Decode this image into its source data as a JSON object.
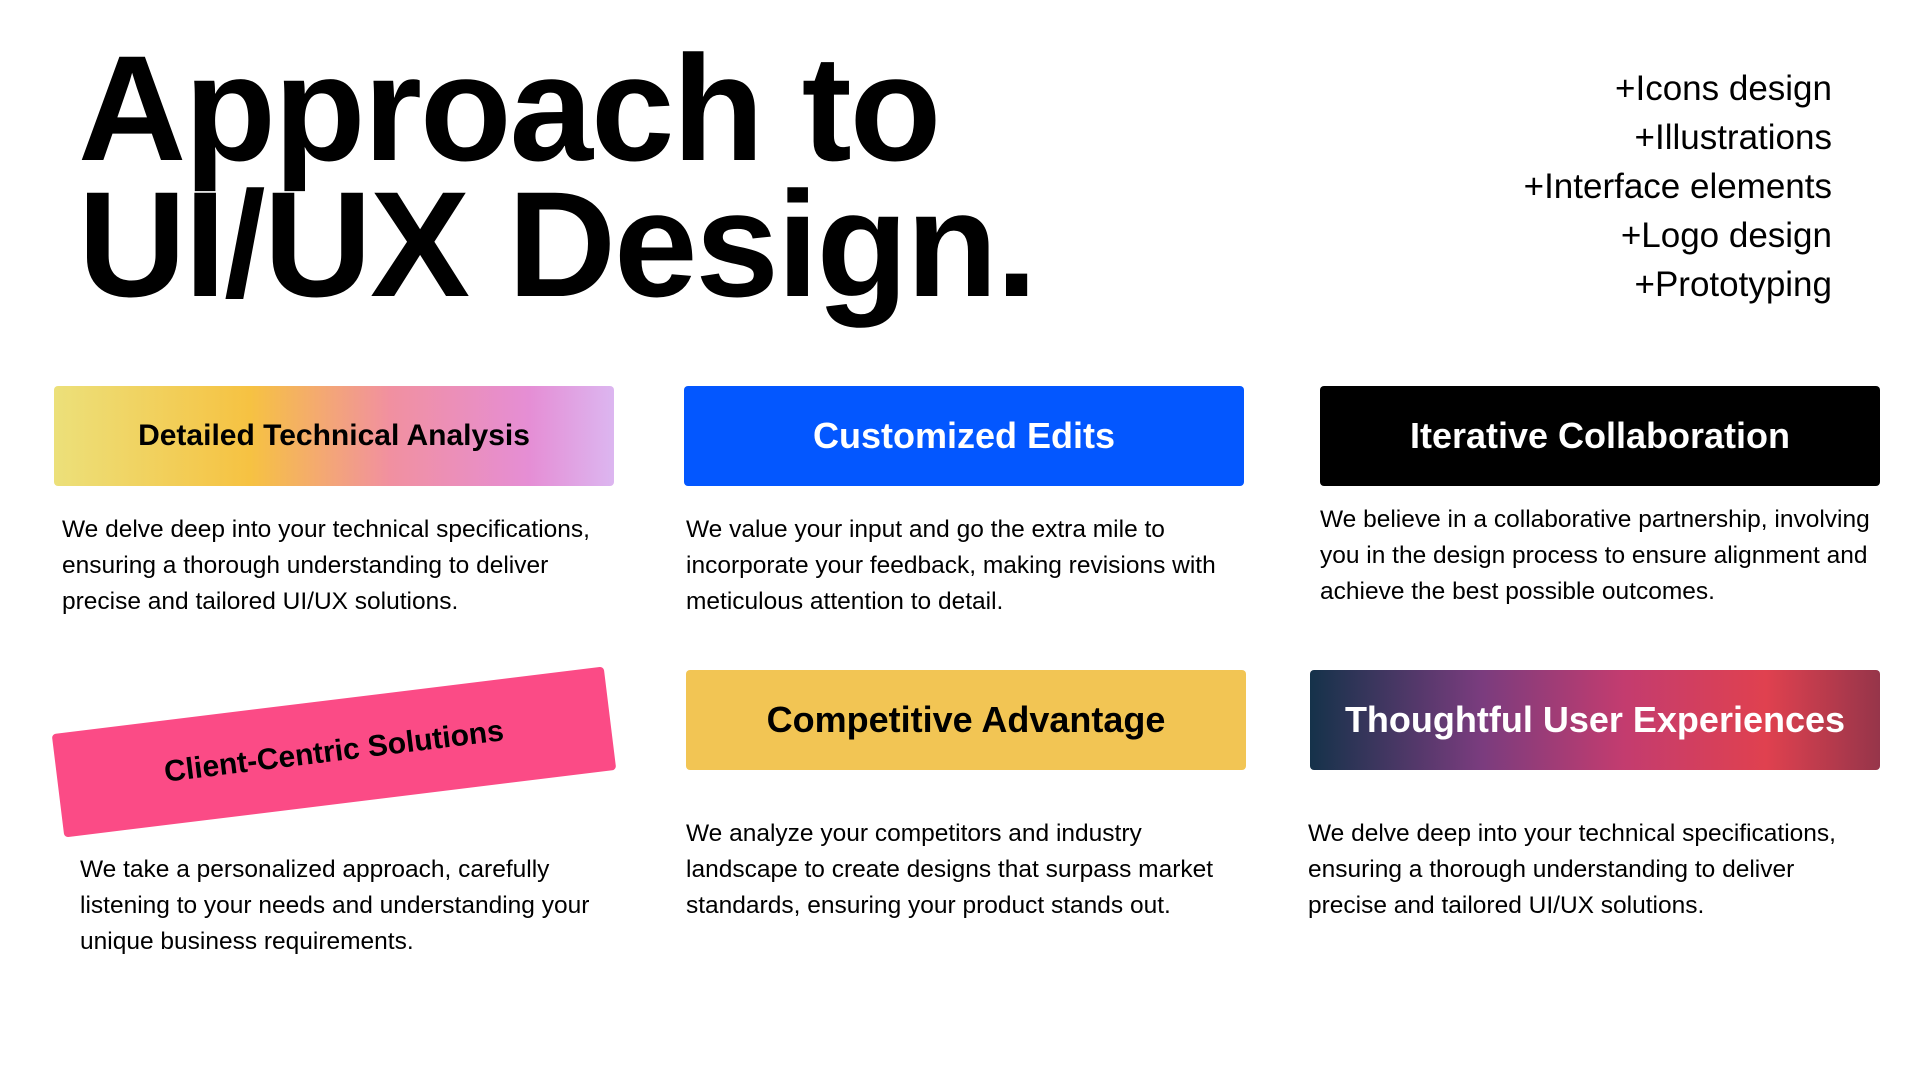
{
  "title": {
    "line1": "Approach to",
    "line2": "UI/UX Design."
  },
  "services": [
    "+Icons design",
    "+Illustrations",
    "+Interface elements",
    "+Logo design",
    "+Prototyping"
  ],
  "cards": [
    {
      "label": "Detailed Technical Analysis",
      "text": "We delve deep into your technical specifications, ensuring a thorough understanding to deliver precise and tailored UI/UX solutions."
    },
    {
      "label": "Customized Edits",
      "text": "We value your input and go the extra mile to incorporate your feedback, making revisions with meticulous attention to detail."
    },
    {
      "label": "Iterative Collaboration",
      "text": "We believe in a collaborative partnership, involving you in the design process to ensure alignment and achieve the best possible outcomes."
    },
    {
      "label": "Client-Centric Solutions",
      "text": "We take a personalized approach, carefully listening to your needs and understanding your unique business requirements."
    },
    {
      "label": "Competitive Advantage",
      "text": "We analyze your competitors and industry landscape to create designs that surpass market standards, ensuring your product stands out."
    },
    {
      "label": "Thoughtful User Experiences",
      "text": "We delve deep into your technical specifications, ensuring a thorough understanding to deliver precise and tailored UI/UX solutions."
    }
  ],
  "colors": {
    "customized_edits": "#0357ff",
    "iterative_collaboration": "#000000",
    "client_centric": "#fb4b86",
    "competitive_advantage": "#f2c554"
  }
}
